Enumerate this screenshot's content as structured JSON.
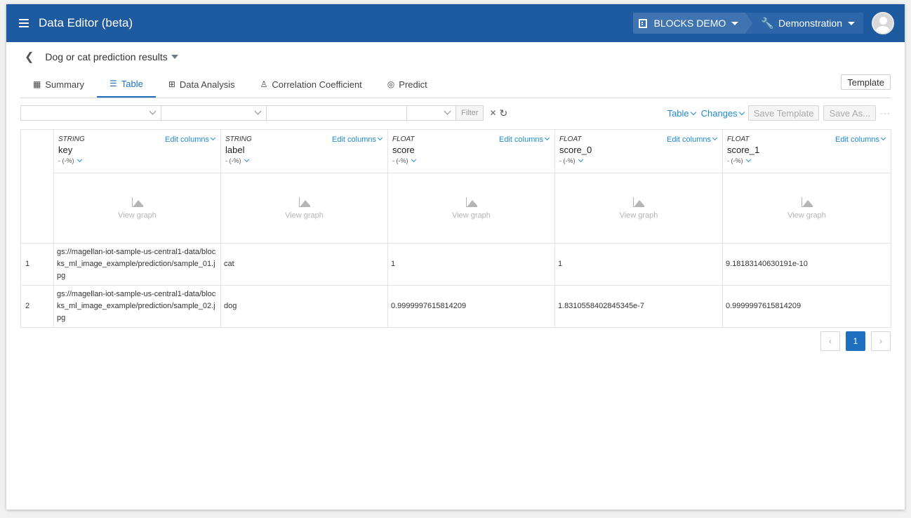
{
  "app": {
    "title": "Data Editor (beta)"
  },
  "header": {
    "org_label": "BLOCKS DEMO",
    "project_label": "Demonstration"
  },
  "breadcrumb": {
    "title": "Dog or cat prediction results"
  },
  "tabs": [
    {
      "label": "Summary",
      "icon": "grid-icon"
    },
    {
      "label": "Table",
      "icon": "table-icon",
      "active": true
    },
    {
      "label": "Data Analysis",
      "icon": "plus-square-icon"
    },
    {
      "label": "Correlation Coefficient",
      "icon": "lightbulb-icon"
    },
    {
      "label": "Predict",
      "icon": "magnifier-chart-icon"
    }
  ],
  "template_button": "Template",
  "filter": {
    "filter_label": "Filter"
  },
  "toolbar": {
    "table_label": "Table",
    "changes_label": "Changes",
    "save_template_label": "Save Template",
    "save_as_label": "Save As..."
  },
  "columns": [
    {
      "type": "STRING",
      "name": "key",
      "null_pct": "- (-%)",
      "edit": "Edit columns",
      "graph": "View graph"
    },
    {
      "type": "STRING",
      "name": "label",
      "null_pct": "- (-%)",
      "edit": "Edit columns",
      "graph": "View graph"
    },
    {
      "type": "FLOAT",
      "name": "score",
      "null_pct": "- (-%)",
      "edit": "Edit columns",
      "graph": "View graph"
    },
    {
      "type": "FLOAT",
      "name": "score_0",
      "null_pct": "- (-%)",
      "edit": "Edit columns",
      "graph": "View graph"
    },
    {
      "type": "FLOAT",
      "name": "score_1",
      "null_pct": "- (-%)",
      "edit": "Edit columns",
      "graph": "View graph"
    }
  ],
  "rows": [
    {
      "idx": "1",
      "key": "gs://magellan-iot-sample-us-central1-data/blocks_ml_image_example/prediction/sample_01.jpg",
      "label": "cat",
      "score": "1",
      "score_0": "1",
      "score_1": "9.18183140630191e-10"
    },
    {
      "idx": "2",
      "key": "gs://magellan-iot-sample-us-central1-data/blocks_ml_image_example/prediction/sample_02.jpg",
      "label": "dog",
      "score": "0.9999997615814209",
      "score_0": "1.8310558402845345e-7",
      "score_1": "0.9999997615814209"
    }
  ],
  "pagination": {
    "prev": "‹",
    "current": "1",
    "next": "›"
  }
}
